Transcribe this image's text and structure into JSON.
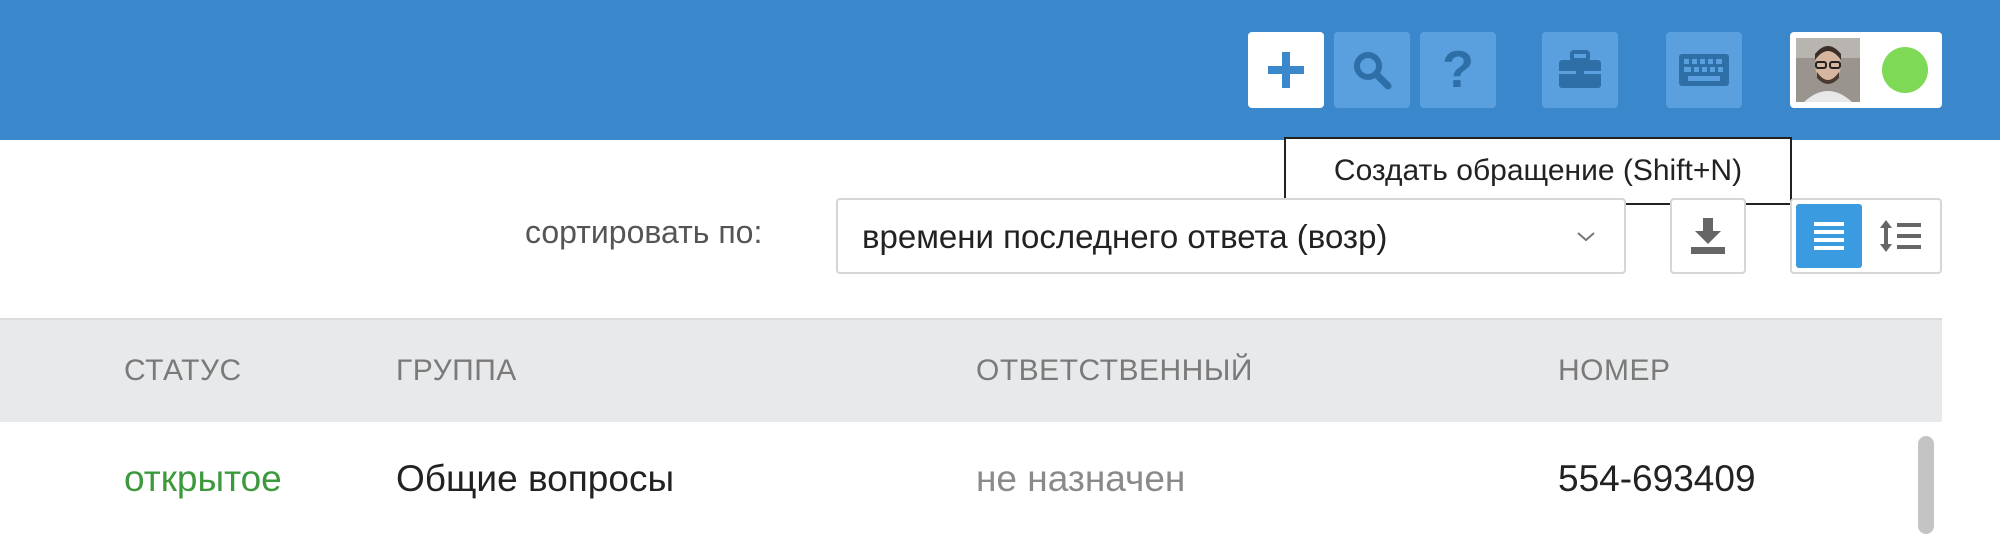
{
  "toolbar": {
    "buttons": [
      {
        "name": "plus-icon",
        "active": true
      },
      {
        "name": "search-icon",
        "active": false
      },
      {
        "name": "help-icon",
        "active": false
      },
      {
        "name": "briefcase-icon",
        "active": false
      },
      {
        "name": "keyboard-icon",
        "active": false
      }
    ],
    "status_color": "#7ed957",
    "help_glyph": "?"
  },
  "tooltip": {
    "text": "Создать обращение (Shift+N)"
  },
  "sort": {
    "label": "сортировать по:",
    "selected": "времени последнего ответа (возр)"
  },
  "table": {
    "columns": [
      "СТАТУС",
      "ГРУППА",
      "ОТВЕТСТВЕННЫЙ",
      "НОМЕР"
    ],
    "rows": [
      {
        "status": "открытое",
        "group": "Общие вопросы",
        "assignee": "не назначен",
        "number": "554-693409"
      }
    ]
  },
  "colors": {
    "topbar": "#3b87cb",
    "status_open": "#3c9a3c",
    "unassigned": "#8a8a8a",
    "view_active": "#3b9be0"
  }
}
